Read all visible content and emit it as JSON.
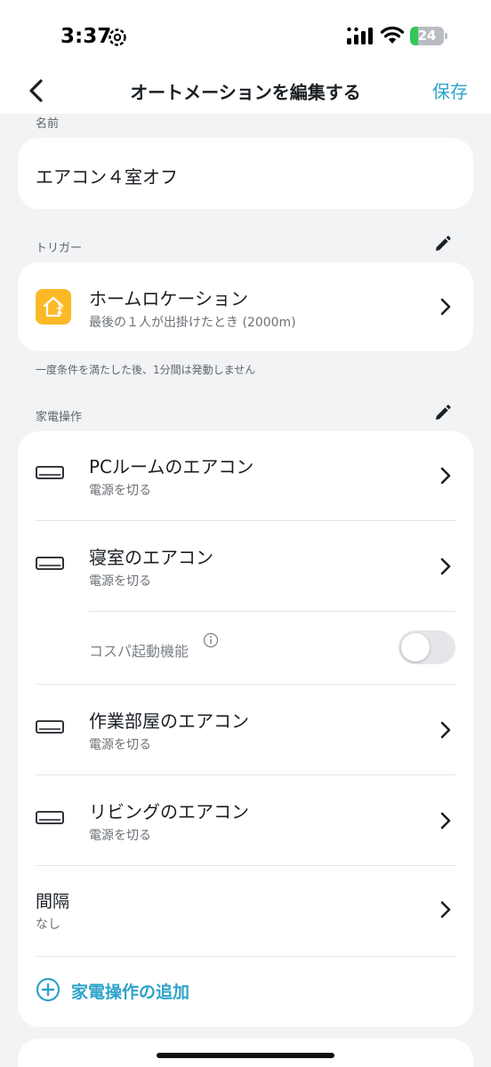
{
  "status_bar": {
    "time": "3:37",
    "battery": "24",
    "battery_level": 0.24
  },
  "nav": {
    "title": "オートメーションを編集する",
    "save_label": "保存"
  },
  "name_section": {
    "label": "名前",
    "value": "エアコン４室オフ"
  },
  "trigger_section": {
    "label": "トリガー",
    "title": "ホームロケーション",
    "subtitle": "最後の１人が出掛けたとき (2000m)",
    "icon": "home-location-icon",
    "icon_color": "#fbb928"
  },
  "note": "一度条件を満たした後、1分間は発動しません",
  "device_section": {
    "label": "家電操作",
    "devices": [
      {
        "name": "PCルームのエアコン",
        "action": "電源を切る"
      },
      {
        "name": "寝室のエアコン",
        "action": "電源を切る"
      },
      {
        "name": "作業部屋のエアコン",
        "action": "電源を切る"
      },
      {
        "name": "リビングのエアコン",
        "action": "電源を切る"
      }
    ],
    "cospa": {
      "label": "コスパ起動機能",
      "enabled": false
    },
    "interval": {
      "title": "間隔",
      "value": "なし"
    },
    "add_label": "家電操作の追加"
  },
  "colors": {
    "accent": "#2ea3c9",
    "background": "#f2f3f5",
    "card": "#ffffff"
  }
}
